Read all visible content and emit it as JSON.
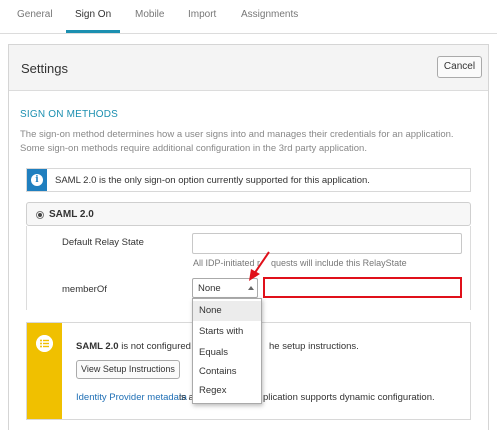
{
  "tabs": [
    "General",
    "Sign On",
    "Mobile",
    "Import",
    "Assignments"
  ],
  "active_tab": "Sign On",
  "panel": {
    "title": "Settings",
    "cancel_label": "Cancel"
  },
  "sign_on": {
    "section_title": "SIGN ON METHODS",
    "description": "The sign-on method determines how a user signs into and manages their credentials for an application. Some sign-on methods require additional configuration in the 3rd party application.",
    "info_text": "SAML 2.0 is the only sign-on option currently supported for this application.",
    "method_label": "SAML 2.0",
    "relay_state_label": "Default Relay State",
    "relay_state_value": "",
    "relay_hint_a": "All IDP-initiated r",
    "relay_hint_b": "quests will include this RelayState",
    "member_of_label": "memberOf",
    "member_of_selected": "None",
    "member_of_options": [
      "None",
      "Starts with",
      "Equals",
      "Contains",
      "Regex"
    ],
    "member_of_value": ""
  },
  "warning": {
    "text_bold": "SAML 2.0",
    "text_rest": "is not configured unt",
    "text_rest_b": "he setup instructions.",
    "button_label": "View Setup Instructions",
    "link_text": "Identity Provider metadata",
    "text_after_link": "is av",
    "text_tail": "plication supports dynamic configuration."
  },
  "colors": {
    "accent": "#1b8fb0",
    "info_blue": "#1f7fbf",
    "warning_yellow": "#f0c000",
    "highlight_red": "#e0101a"
  }
}
